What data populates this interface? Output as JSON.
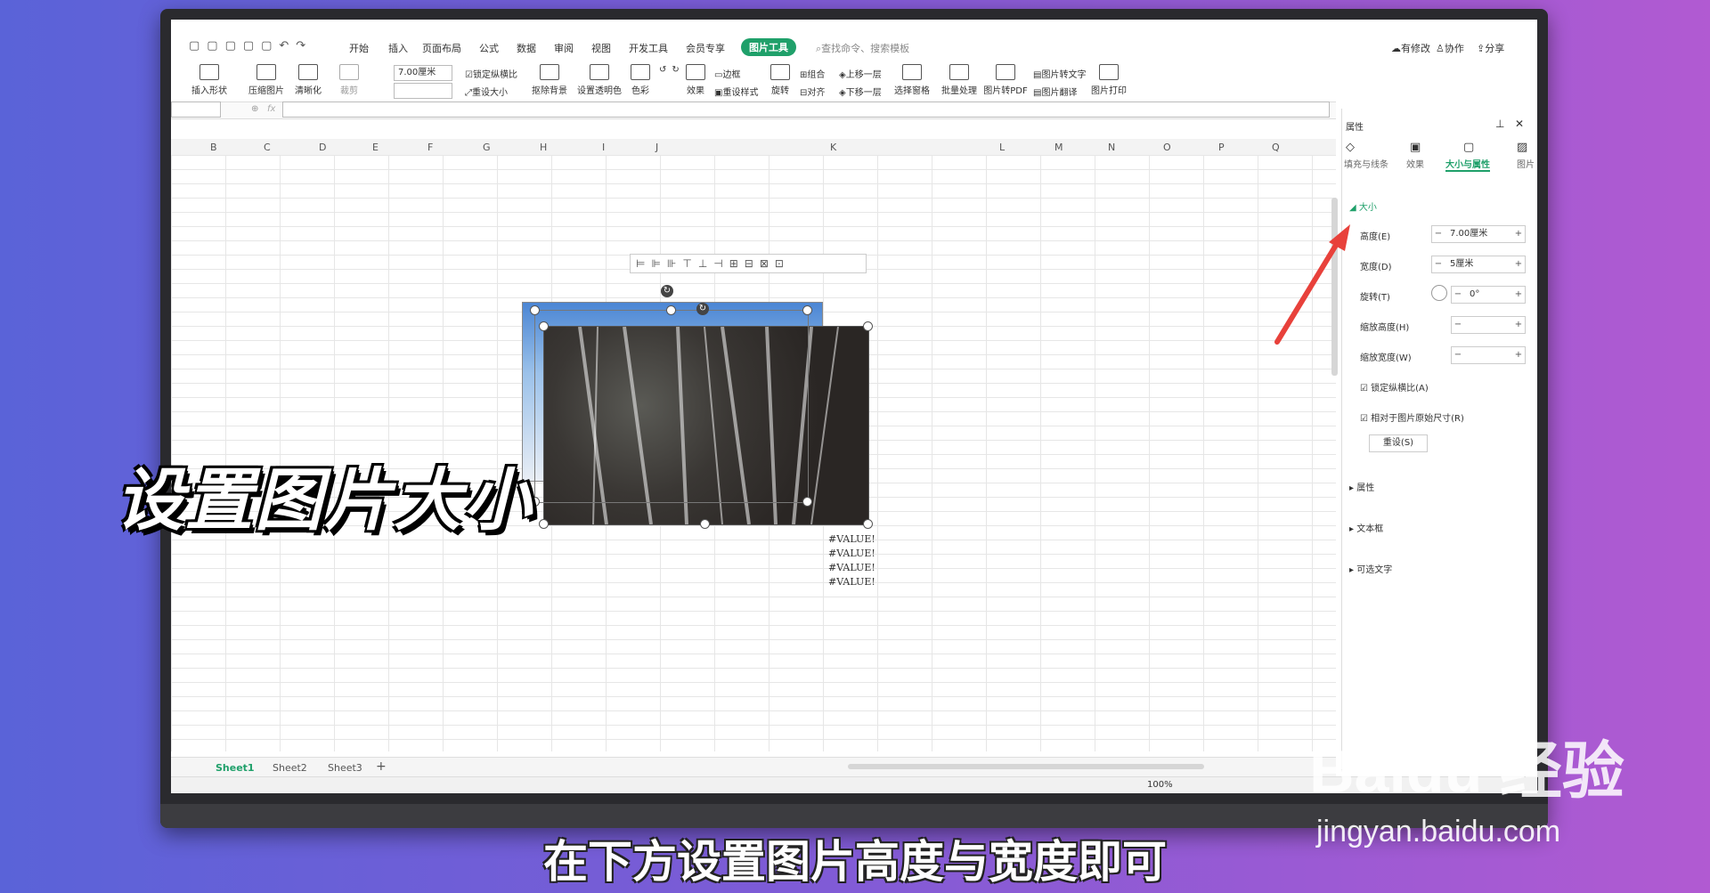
{
  "menu_tabs": [
    "开始",
    "插入",
    "页面布局",
    "公式",
    "数据",
    "审阅",
    "视图",
    "开发工具",
    "会员专享"
  ],
  "active_tab": "图片工具",
  "search_placeholder": "查找命令、搜索模板",
  "top_right": {
    "modify": "有修改",
    "collab": "协作",
    "share": "分享"
  },
  "ribbon": {
    "insert_shape": "插入形状",
    "compress": "压缩图片",
    "clarify": "清晰化",
    "crop": "裁剪",
    "height_value": "7.00厘米",
    "lock_ratio": "锁定纵横比",
    "reset_size": "重设大小",
    "remove_bg": "抠除背景",
    "transparent": "设置透明色",
    "color": "色彩",
    "effect": "效果",
    "border": "边框",
    "reset_style": "重设样式",
    "rotate": "旋转",
    "combine": "组合",
    "align": "对齐",
    "up_layer": "上移一层",
    "down_layer": "下移一层",
    "select_pane": "选择窗格",
    "batch": "批量处理",
    "to_pdf": "图片转PDF",
    "to_text": "图片转文字",
    "translate": "图片翻译",
    "print": "图片打印"
  },
  "formula_label": "fx",
  "columns": [
    "B",
    "C",
    "D",
    "E",
    "F",
    "G",
    "H",
    "I",
    "J",
    "K",
    "L",
    "M",
    "N",
    "O",
    "P",
    "Q"
  ],
  "errors": [
    "#VALUE!",
    "#VALUE!",
    "#VALUE!",
    "#VALUE!"
  ],
  "sheets": [
    "Sheet1",
    "Sheet2",
    "Sheet3"
  ],
  "panel": {
    "title": "属性",
    "tabs": [
      "填充与线条",
      "效果",
      "大小与属性",
      "图片"
    ],
    "section_size": "大小",
    "height_label": "高度(E)",
    "height_value": "7.00厘米",
    "width_label": "宽度(D)",
    "width_value": "5厘米",
    "rotate_label": "旋转(T)",
    "rotate_value": "0°",
    "scale_h_label": "缩放高度(H)",
    "scale_w_label": "缩放宽度(W)",
    "lock_ratio": "锁定纵横比(A)",
    "relative": "相对于图片原始尺寸(R)",
    "reset": "重设(S)",
    "sections": [
      "属性",
      "文本框",
      "可选文字"
    ]
  },
  "zoom": "100%",
  "overlay_title": "设置图片大小",
  "subtitle": "在下方设置图片高度与宽度即可",
  "watermark": {
    "brand": "Baidu 经验",
    "url": "jingyan.baidu.com"
  },
  "colors": {
    "accent": "#1fa06a",
    "arrow": "#e8413b"
  }
}
